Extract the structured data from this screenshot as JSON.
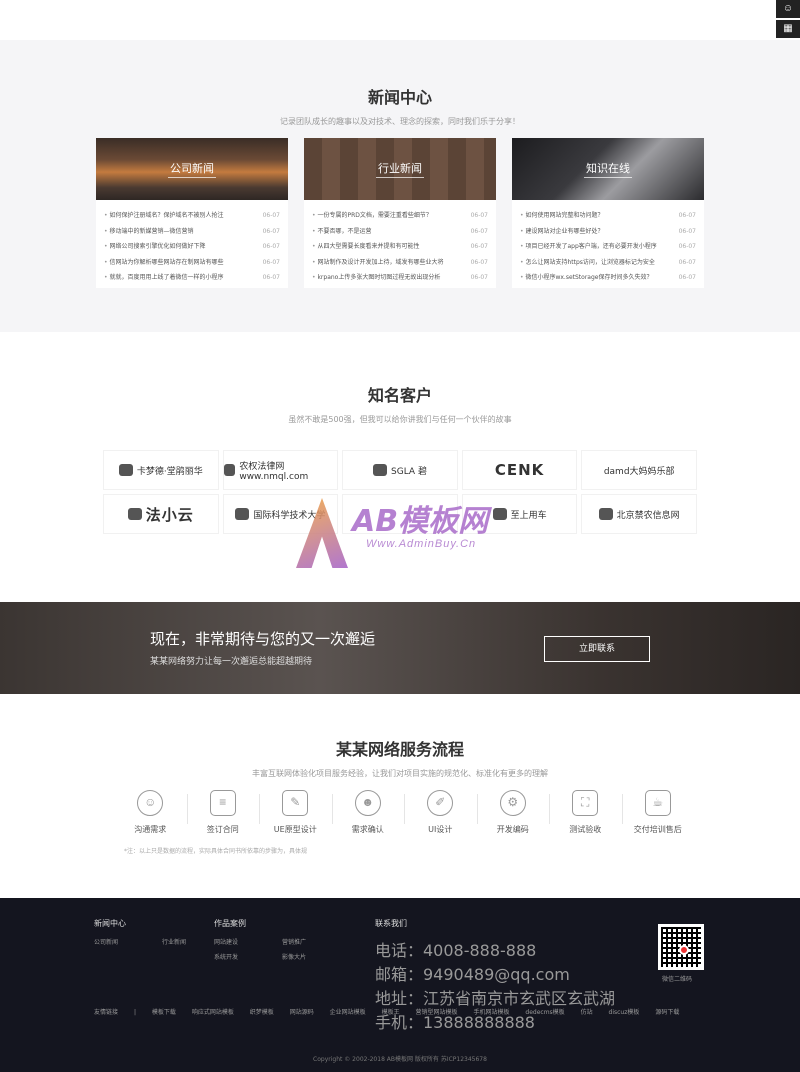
{
  "side_tools": [
    {
      "icon": "chat-icon",
      "glyph": "☺"
    },
    {
      "icon": "qrcode-icon",
      "glyph": "▦"
    }
  ],
  "news": {
    "title": "新闻中心",
    "subtitle": "记录团队成长的趣事以及对技术、理念的探索，同时我们乐于分享！",
    "cards": [
      {
        "title": "公司新闻",
        "items": [
          {
            "text": "如何保护注册域名？保护域名不被别人抢注",
            "date": "06-07"
          },
          {
            "text": "移动端中的新媒营销—微信营销",
            "date": "06-07"
          },
          {
            "text": "网络公司搜索引擎优化如何做好下降",
            "date": "06-07"
          },
          {
            "text": "信网站为你解析哪些网站存在制网站有哪些",
            "date": "06-07"
          },
          {
            "text": "就就，百度用用上线了着微信一样的小程序",
            "date": "06-07"
          }
        ]
      },
      {
        "title": "行业新闻",
        "items": [
          {
            "text": "一份专属的PRD文档，需要注重看些细节？",
            "date": "06-07"
          },
          {
            "text": "不要否哪，不是运营",
            "date": "06-07"
          },
          {
            "text": "从四大型需要长度看来并提和有可能性",
            "date": "06-07"
          },
          {
            "text": "网站制作及设计开发加上待，域发有哪些业大将",
            "date": "06-07"
          },
          {
            "text": "krpano上传多张大图时切图过程无故出现分析",
            "date": "06-07"
          }
        ]
      },
      {
        "title": "知识在线",
        "items": [
          {
            "text": "如何使用网站完整和功问题？",
            "date": "06-07"
          },
          {
            "text": "建设网站对企业有哪些好处？",
            "date": "06-07"
          },
          {
            "text": "项目已经开发了app客户端，还有必要开发小程序",
            "date": "06-07"
          },
          {
            "text": "怎么让网站支持https访问，让浏览器标记为安全",
            "date": "06-07"
          },
          {
            "text": "微信小程序wx.setStorage保存时间多久失效？",
            "date": "06-07"
          }
        ]
      }
    ]
  },
  "clients": {
    "title": "知名客户",
    "subtitle": "虽然不敢是500强，但我可以给你讲我们与任何一个伙伴的故事",
    "logos": [
      {
        "name": "卡梦德·堂鹃丽华",
        "big": false
      },
      {
        "name": "农权法律网 www.nmql.com",
        "big": false
      },
      {
        "name": "SGLA 碧",
        "big": false
      },
      {
        "name": "CENK",
        "big": true
      },
      {
        "name": "damd大妈妈乐部",
        "big": false
      },
      {
        "name": "法小云",
        "big": true
      },
      {
        "name": "国际科学技术大学",
        "big": false
      },
      {
        "name": "",
        "big": false
      },
      {
        "name": "至上用车",
        "big": false
      },
      {
        "name": "北京禁农信息网",
        "big": false
      }
    ]
  },
  "watermark": {
    "brand": "AB模板网",
    "url": "Www.AdminBuy.Cn"
  },
  "cta": {
    "title": "现在，非常期待与您的又一次邂逅",
    "subtitle": "某某网络努力让每一次邂逅总能超越期待",
    "button": "立即联系"
  },
  "process": {
    "title": "某某网络服务流程",
    "subtitle": "丰富互联网体验化项目服务经验，让我们对项目实施的规范化、标准化有更多的理解",
    "steps": [
      {
        "label": "沟通需求",
        "icon": "smile-icon",
        "glyph": "☺",
        "round": true
      },
      {
        "label": "签订合同",
        "icon": "contract-icon",
        "glyph": "≡",
        "round": false
      },
      {
        "label": "UE原型设计",
        "icon": "edit-icon",
        "glyph": "✎",
        "round": false
      },
      {
        "label": "需求确认",
        "icon": "users-icon",
        "glyph": "☻",
        "round": true
      },
      {
        "label": "UI设计",
        "icon": "palette-icon",
        "glyph": "✐",
        "round": true
      },
      {
        "label": "开发编码",
        "icon": "gear-icon",
        "glyph": "⚙",
        "round": true
      },
      {
        "label": "测试验收",
        "icon": "scan-icon",
        "glyph": "⛶",
        "round": false
      },
      {
        "label": "交付培训售后",
        "icon": "coffee-icon",
        "glyph": "☕",
        "round": false
      }
    ],
    "note": "*注：以上只是数据的流程，实际具体合同书所依靠的步骤为，具体规"
  },
  "footer": {
    "news_title": "新闻中心",
    "news_links": [
      "公司新闻",
      "行业新闻"
    ],
    "cases_title": "作品案例",
    "cases_links": [
      "网站建设",
      "营销推广",
      "系统开发",
      "影像大片"
    ],
    "contact_title": "联系我们",
    "contact": [
      "电话：4008-888-888",
      "邮箱：9490489@qq.com",
      "地址：江苏省南京市玄武区玄武湖",
      "手机：13888888888"
    ],
    "qr_caption": "微信二维码",
    "friend_links": [
      "友情链接",
      "|",
      "模板下载",
      "响应式网站模板",
      "织梦模板",
      "网站源码",
      "企业网站模板",
      "模板王",
      "营销型网站模板",
      "手机网站模板",
      "dedecms模板",
      "仿站",
      "discuz模板",
      "源码下载"
    ],
    "copyright": "Copyright © 2002-2018 AB模板网 版权所有  苏ICP12345678"
  }
}
